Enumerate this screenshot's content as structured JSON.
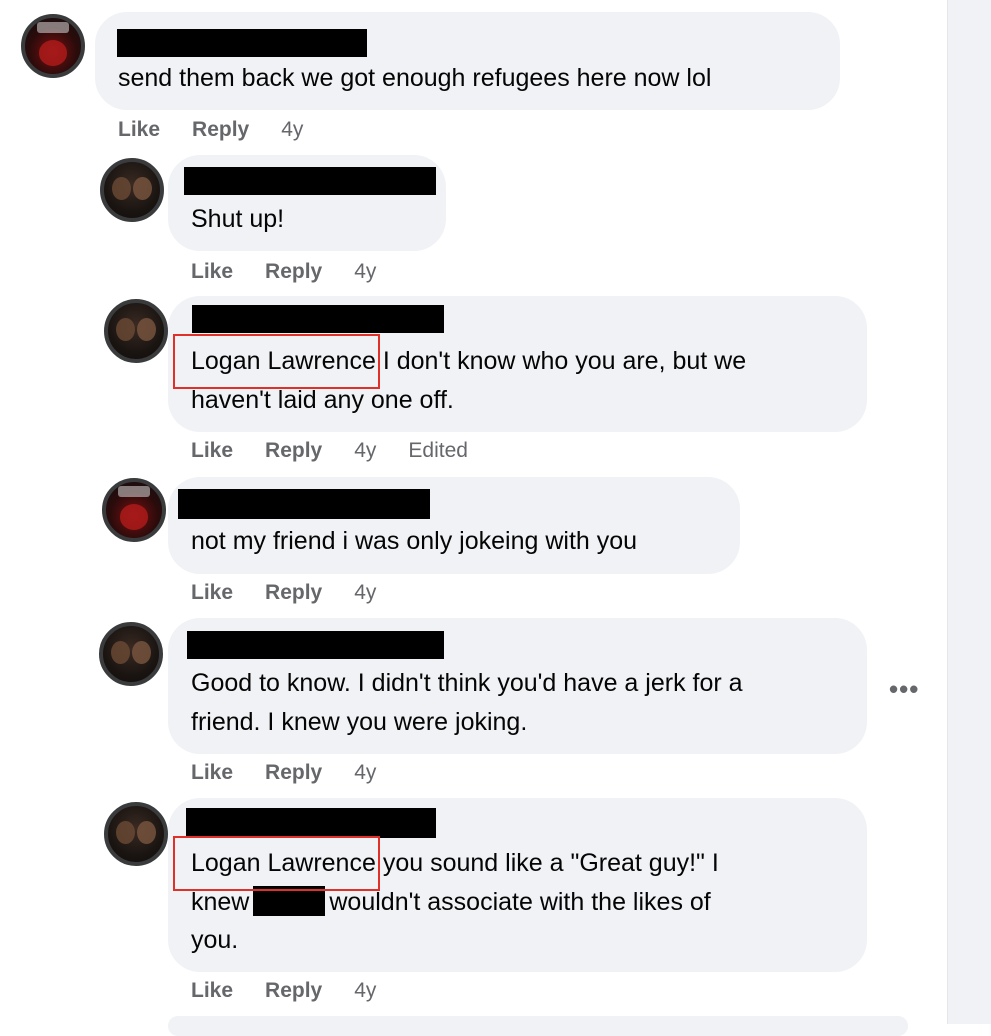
{
  "comments": [
    {
      "text_lines": [
        "send them back we got enough refugees here now lol"
      ],
      "actions": {
        "like": "Like",
        "reply": "Reply",
        "time": "4y"
      }
    },
    {
      "text_lines": [
        "Shut up!"
      ],
      "actions": {
        "like": "Like",
        "reply": "Reply",
        "time": "4y"
      }
    },
    {
      "mention": "Logan Lawrence",
      "text_line1_rest": " I don't know who you are, but we",
      "text_line2": "haven't laid any one off.",
      "actions": {
        "like": "Like",
        "reply": "Reply",
        "time": "4y",
        "edited": "Edited"
      }
    },
    {
      "text_lines": [
        "not my friend i was only jokeing with you"
      ],
      "actions": {
        "like": "Like",
        "reply": "Reply",
        "time": "4y"
      }
    },
    {
      "text_lines": [
        "Good to know. I didn't think you'd have a jerk for a",
        "friend. I knew you were joking."
      ],
      "actions": {
        "like": "Like",
        "reply": "Reply",
        "time": "4y"
      },
      "more_options": "•••"
    },
    {
      "mention": "Logan Lawrence",
      "text_line1_rest": " you sound like a \"Great guy!\" I",
      "text_line2_start": "knew",
      "text_line2_end": "wouldn't associate with the likes of",
      "text_line3": "you.",
      "actions": {
        "like": "Like",
        "reply": "Reply",
        "time": "4y"
      }
    }
  ],
  "icons": {
    "avatar_ohio": "ohio-state-avatar",
    "avatar_couple": "couple-photo-avatar",
    "more": "more-options-icon"
  },
  "colors": {
    "bubble": "#f0f2f5",
    "meta_text": "#65676b",
    "mention_box": "#e0302a",
    "redaction": "#000000"
  }
}
